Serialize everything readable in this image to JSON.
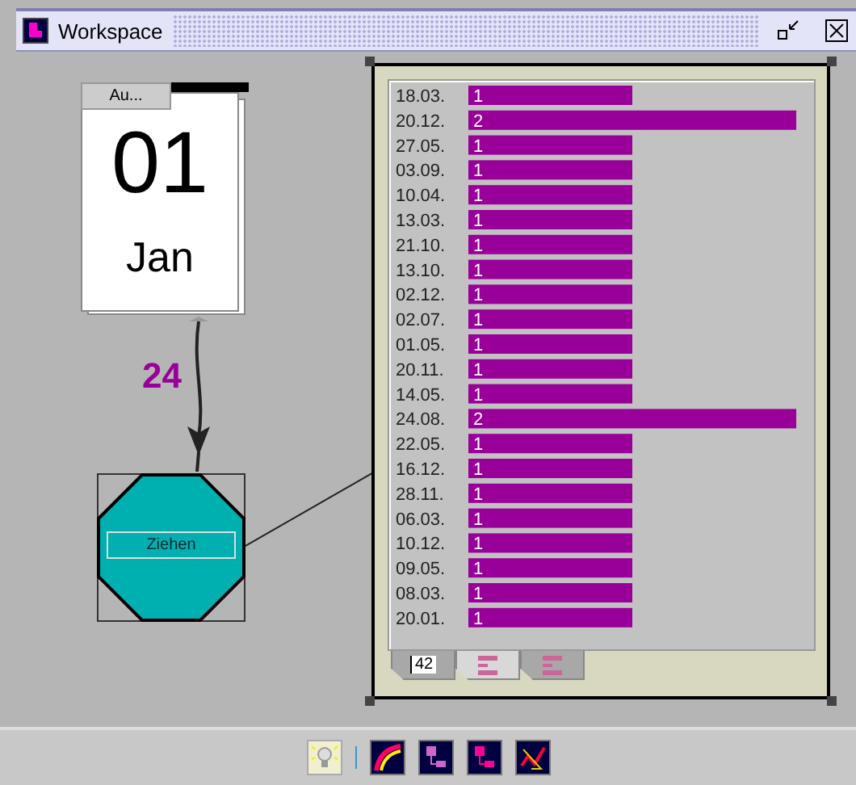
{
  "window": {
    "title": "Workspace"
  },
  "calendar": {
    "tab": "Au...",
    "day": "01",
    "month": "Jan"
  },
  "connector": {
    "label": "24"
  },
  "node": {
    "label": "Ziehen"
  },
  "chart_panel": {
    "chart_data": {
      "type": "bar",
      "orientation": "horizontal",
      "data_labels": true,
      "categories": [
        "18.03.",
        "20.12.",
        "27.05.",
        "03.09.",
        "10.04.",
        "13.03.",
        "21.10.",
        "13.10.",
        "02.12.",
        "02.07.",
        "01.05.",
        "20.11.",
        "14.05.",
        "24.08.",
        "22.05.",
        "16.12.",
        "28.11.",
        "06.03.",
        "10.12.",
        "09.05.",
        "08.03.",
        "20.01."
      ],
      "series": [
        {
          "color": "#990099",
          "values": [
            1,
            2,
            1,
            1,
            1,
            1,
            1,
            1,
            1,
            1,
            1,
            1,
            1,
            2,
            1,
            1,
            1,
            1,
            1,
            1,
            1,
            1
          ]
        }
      ]
    },
    "tabs": [
      {
        "kind": "number",
        "label": "42",
        "selected": false
      },
      {
        "kind": "list",
        "selected": true
      },
      {
        "kind": "list",
        "selected": false
      }
    ]
  }
}
